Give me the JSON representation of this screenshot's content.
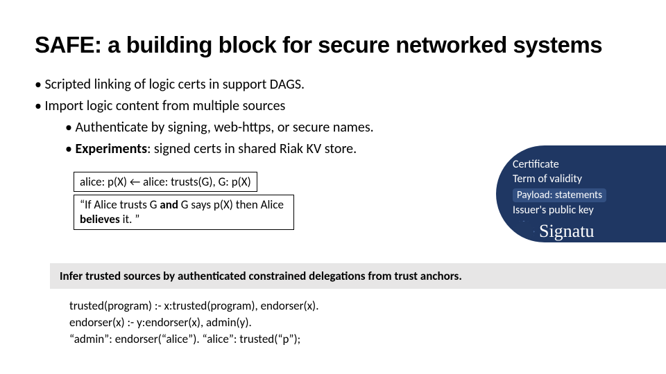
{
  "title": "SAFE: a building block for secure networked systems",
  "bullets": {
    "b1a": "Scripted linking of logic certs in support DAGS.",
    "b1b": "Import logic content from multiple sources",
    "b2a": "Authenticate by signing, web-https, or secure names.",
    "b2b_prefix": "Experiments",
    "b2b_rest": ": signed certs in shared Riak KV store."
  },
  "rule_box": "alice: p(X) ← alice: trusts(G), G: p(X)",
  "quote_box_pre": "“If Alice trusts G ",
  "quote_box_and": "and",
  "quote_box_mid": " G says p(X) then Alice ",
  "quote_box_bel": "believes",
  "quote_box_post": " it. ”",
  "cert": {
    "l1": "Certificate",
    "l2": "Term of validity",
    "payload": "Payload: statements",
    "l4": "Issuer's public key",
    "sig": "Signatu"
  },
  "greybar": "Infer trusted sources by authenticated constrained delegations from trust anchors.",
  "code": {
    "l1": "trusted(program) :- x:trusted(program), endorser(x).",
    "l2": "endorser(x) :-  y:endorser(x), admin(y).",
    "l3": "“admin”: endorser(“alice”).   “alice”: trusted(“p”);"
  }
}
